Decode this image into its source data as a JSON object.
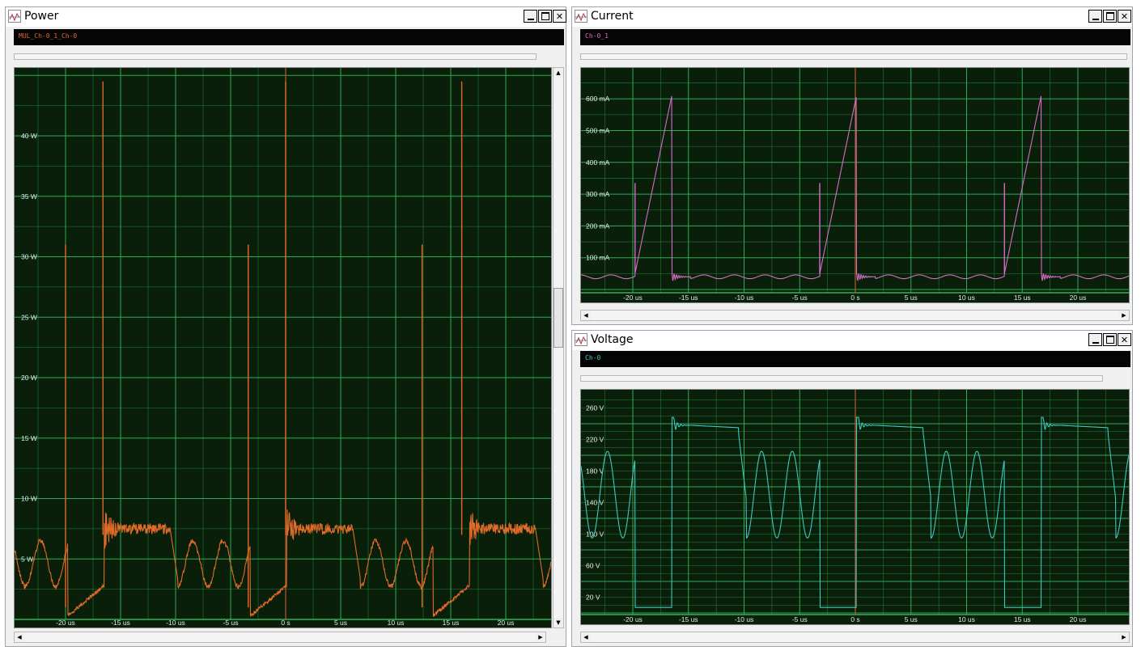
{
  "windows": {
    "power": {
      "title": "Power",
      "channel": "MUL_Ch-0_1_Ch-0",
      "color": "#e06a28",
      "unit": "W",
      "y_ticks": [
        "40 W",
        "35 W",
        "30 W",
        "25 W",
        "20 W",
        "15 W",
        "10 W",
        "5 W"
      ]
    },
    "current": {
      "title": "Current",
      "channel": "Ch-0_1",
      "color": "#d86bc8",
      "unit": "mA",
      "y_ticks": [
        "600 mA",
        "500 mA",
        "400 mA",
        "300 mA",
        "200 mA",
        "100 mA"
      ]
    },
    "voltage": {
      "title": "Voltage",
      "channel": "Ch-0",
      "color": "#3ec8c0",
      "unit": "V",
      "y_ticks": [
        "260 V",
        "220 V",
        "180 V",
        "140 V",
        "100 V",
        "60 V",
        "20 V"
      ]
    }
  },
  "x_ticks": [
    "-20 us",
    "-15 us",
    "-10 us",
    "-5 us",
    "0 s",
    "5 us",
    "10 us",
    "15 us",
    "20 us"
  ],
  "colors": {
    "grid": "#2fb35a",
    "plot_bg": "#0a1f0a",
    "cursor": "#d05030"
  },
  "icons": {
    "minimize": "minimize-icon",
    "maximize": "maximize-icon",
    "close": "close-icon",
    "window": "waveform-window-icon"
  },
  "chart_data": [
    {
      "type": "line",
      "title": "Power",
      "series": [
        {
          "name": "MUL_Ch-0_1_Ch-0",
          "period_us": 16.6,
          "baseline_W": 0.3,
          "plateau_W": 7.5,
          "spike_W": [
            31,
            44
          ]
        }
      ],
      "xlim": [
        -25,
        24
      ],
      "ylim": [
        0,
        45
      ],
      "xlabel": "",
      "ylabel": ""
    },
    {
      "type": "line",
      "title": "Current",
      "series": [
        {
          "name": "Ch-0_1",
          "period_us": 16.6,
          "ramp_start_mA": 50,
          "ramp_peak_mA": 610,
          "idle_mA": 40
        }
      ],
      "xlim": [
        -25,
        24
      ],
      "ylim": [
        0,
        650
      ],
      "xlabel": "",
      "ylabel": ""
    },
    {
      "type": "line",
      "title": "Voltage",
      "series": [
        {
          "name": "Ch-0",
          "period_us": 16.6,
          "high_V": 238,
          "low_V": 5,
          "ring_min_V": 95,
          "ring_max_V": 205
        }
      ],
      "xlim": [
        -25,
        24
      ],
      "ylim": [
        0,
        270
      ],
      "xlabel": "",
      "ylabel": ""
    }
  ]
}
